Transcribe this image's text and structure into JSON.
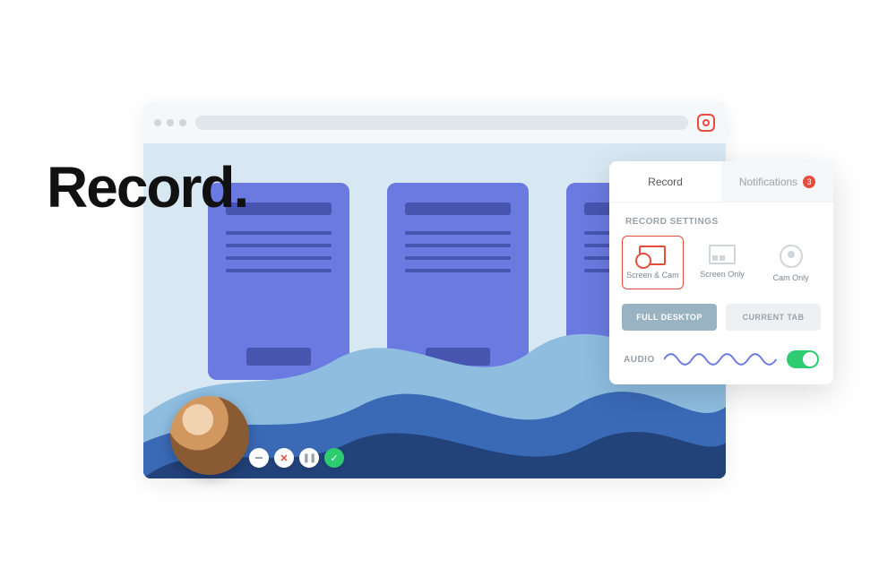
{
  "headline": "Record.",
  "panel": {
    "tabs": {
      "record": "Record",
      "notifications": "Notifications",
      "notif_count": "3"
    },
    "record_settings_title": "RECORD SETTINGS",
    "modes": {
      "screen_cam": "Screen & Cam",
      "screen_only": "Screen Only",
      "cam_only": "Cam Only"
    },
    "scope": {
      "full_desktop": "FULL DESKTOP",
      "current_tab": "CURRENT TAB"
    },
    "audio_label": "AUDIO"
  }
}
